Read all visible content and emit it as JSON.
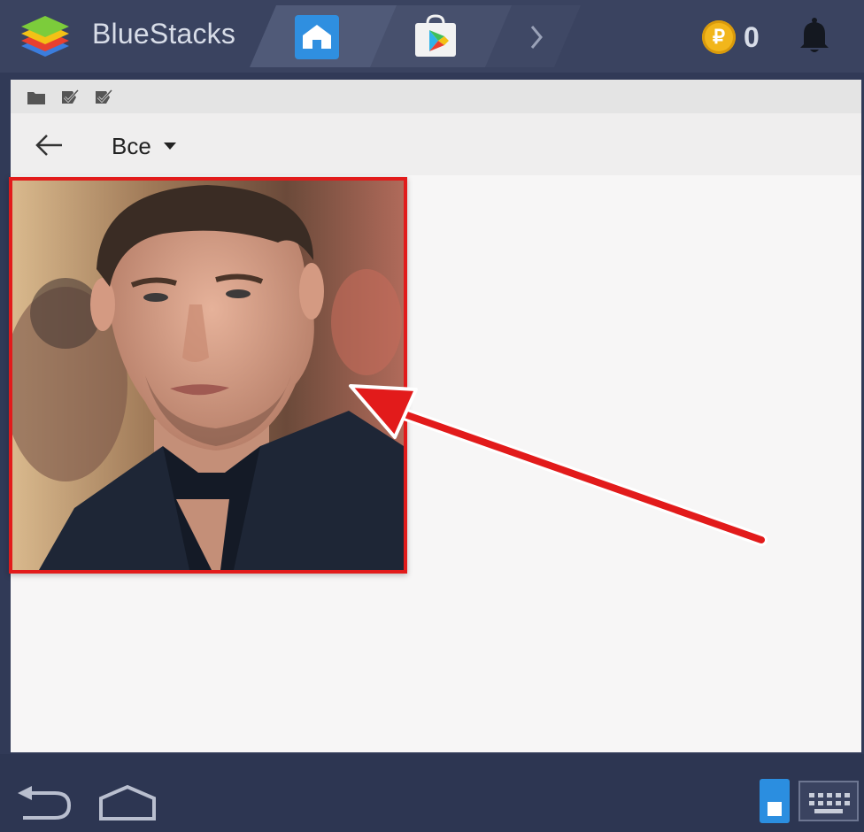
{
  "app": {
    "brand": "BlueStacks"
  },
  "tabs": [
    {
      "icon": "home-icon"
    },
    {
      "icon": "play-store-icon"
    },
    {
      "icon": "chevron-right-icon"
    }
  ],
  "header": {
    "coin_symbol": "₽",
    "coin_count": "0",
    "bell_icon": "bell-icon"
  },
  "statusbar": {
    "icons": [
      "folder-icon",
      "check-icon",
      "check-icon"
    ]
  },
  "toolbar": {
    "filter_label": "Все",
    "back_icon": "back-arrow-icon",
    "caret_icon": "caret-down-icon"
  },
  "gallery": {
    "selected_highlight": "#e21b1b"
  },
  "annotation": {
    "arrow_color": "#e21b1b"
  },
  "nav": {
    "back_icon": "back-icon",
    "home_icon": "home-outline-icon",
    "phone_icon": "phone-icon",
    "keyboard_icon": "keyboard-icon"
  },
  "colors": {
    "accent": "#2f8fe0",
    "topbar": "#3a4360",
    "coin": "#f2b61b"
  }
}
